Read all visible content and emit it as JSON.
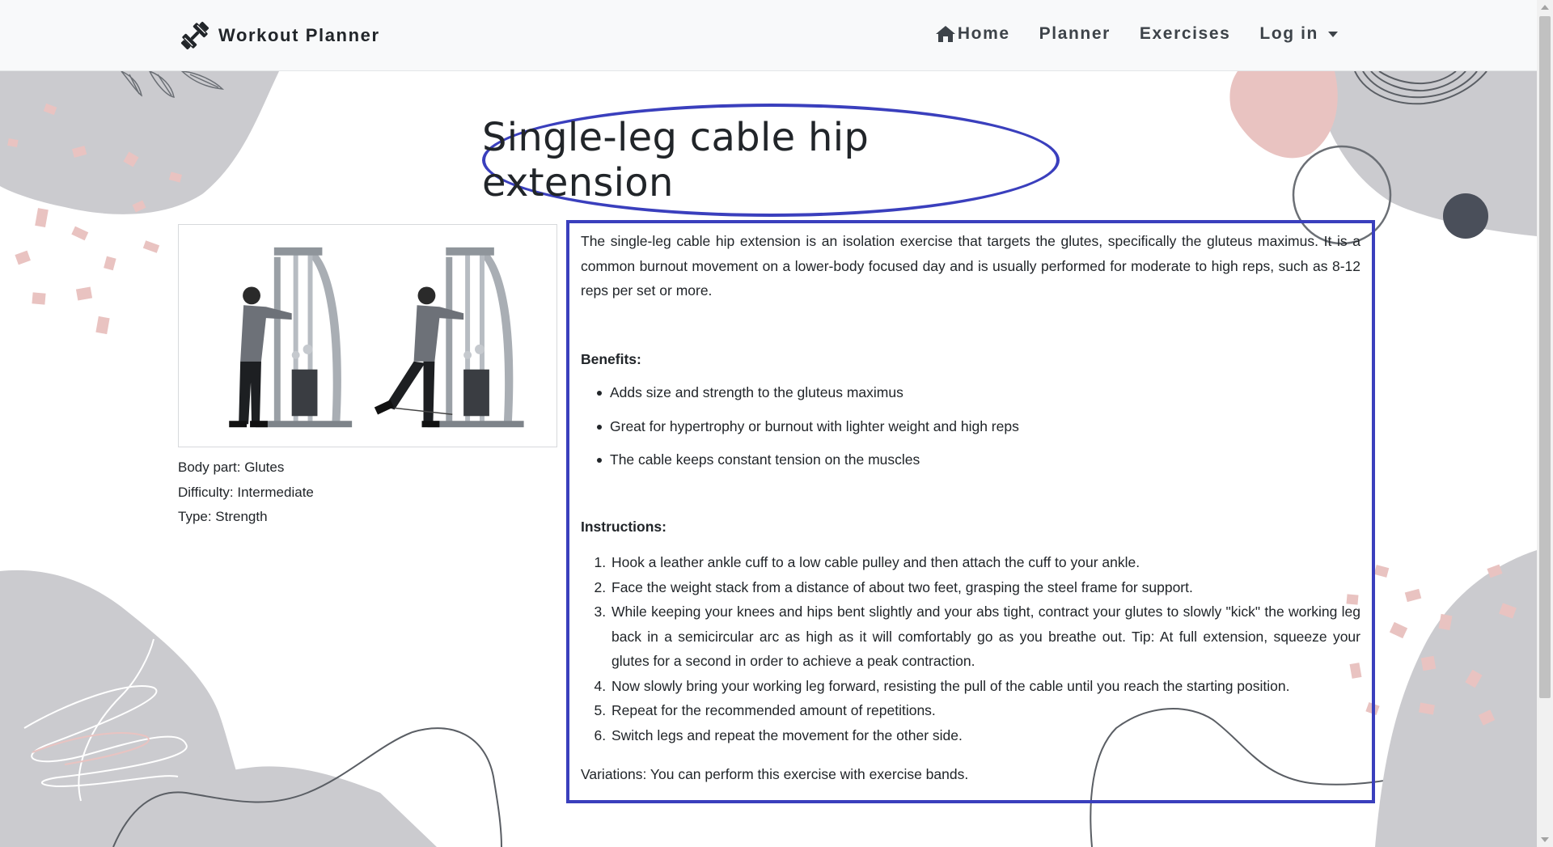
{
  "navbar": {
    "brand": "Workout Planner",
    "links": [
      {
        "label": "Home",
        "icon": "home-icon"
      },
      {
        "label": "Planner"
      },
      {
        "label": "Exercises"
      },
      {
        "label": "Log in",
        "dropdown": true
      }
    ]
  },
  "exercise": {
    "title": "Single-leg cable hip extension",
    "body_part": "Body part: Glutes",
    "difficulty": "Difficulty: Intermediate",
    "type": "Type: Strength",
    "description": "The single-leg cable hip extension is an isolation exercise that targets the glutes, specifically the gluteus maximus. It is a common burnout movement on a lower-body focused day and is usually performed for moderate to high reps, such as 8-12 reps per set or more.",
    "benefits_heading": "Benefits:",
    "benefits": [
      "Adds size and strength to the gluteus maximus",
      "Great for hypertrophy or burnout with lighter weight and high reps",
      "The cable keeps constant tension on the muscles"
    ],
    "instructions_heading": "Instructions:",
    "instructions": [
      "Hook a leather ankle cuff to a low cable pulley and then attach the cuff to your ankle.",
      "Face the weight stack from a distance of about two feet, grasping the steel frame for support.",
      "While keeping your knees and hips bent slightly and your abs tight, contract your glutes to slowly \"kick\" the working leg back in a semicircular arc as high as it will comfortably go as you breathe out. Tip: At full extension, squeeze your glutes for a second in order to achieve a peak contraction.",
      "Now slowly bring your working leg forward, resisting the pull of the cable until you reach the starting position.",
      "Repeat for the recommended amount of repetitions.",
      "Switch legs and repeat the movement for the other side."
    ],
    "variations": "Variations: You can perform this exercise with exercise bands."
  },
  "colors": {
    "annotation": "#3a3fbd",
    "navbar_bg": "#f8f9fa",
    "blob_gray": "#cbcbcf",
    "blob_pink": "#e9c3c1",
    "dark_dot": "#4a4f5a"
  }
}
